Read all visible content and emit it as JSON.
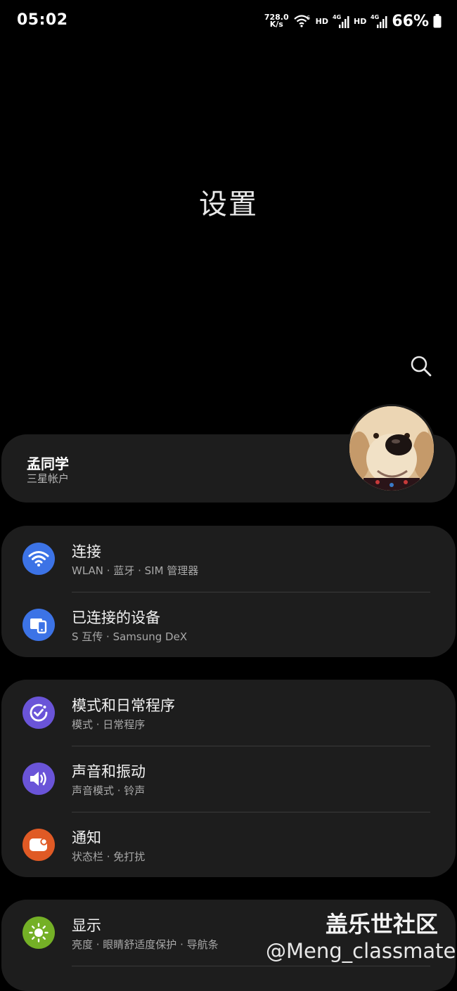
{
  "status_bar": {
    "time": "05:02",
    "net_speed_top": "728.0",
    "net_speed_bottom": "K/s",
    "hd1": "HD",
    "hd2": "HD",
    "net_type1": "4G",
    "net_type2": "4G",
    "wifi_type": "6",
    "battery": "66%"
  },
  "page": {
    "title": "设置"
  },
  "account": {
    "name": "孟同学",
    "subtitle": "三星帐户"
  },
  "groups": [
    {
      "items": [
        {
          "title": "连接",
          "subtitle": "WLAN  ·  蓝牙  ·  SIM 管理器",
          "icon": "wifi-icon",
          "color": "#3c73e6"
        },
        {
          "title": "已连接的设备",
          "subtitle": "S 互传  ·  Samsung DeX",
          "icon": "connected-devices-icon",
          "color": "#3c73e6"
        }
      ]
    },
    {
      "items": [
        {
          "title": "模式和日常程序",
          "subtitle": "模式  ·  日常程序",
          "icon": "check-circle-icon",
          "color": "#6a54d8"
        },
        {
          "title": "声音和振动",
          "subtitle": "声音模式  ·  铃声",
          "icon": "speaker-icon",
          "color": "#6a54d8"
        },
        {
          "title": "通知",
          "subtitle": "状态栏  ·  免打扰",
          "icon": "notification-icon",
          "color": "#e05a25"
        }
      ]
    },
    {
      "items": [
        {
          "title": "显示",
          "subtitle": "亮度  ·  眼睛舒适度保护  ·  导航条",
          "icon": "sun-icon",
          "color": "#74b026"
        }
      ]
    }
  ],
  "watermark": {
    "line1": "盖乐世社区",
    "line2": "@Meng_classmate"
  }
}
